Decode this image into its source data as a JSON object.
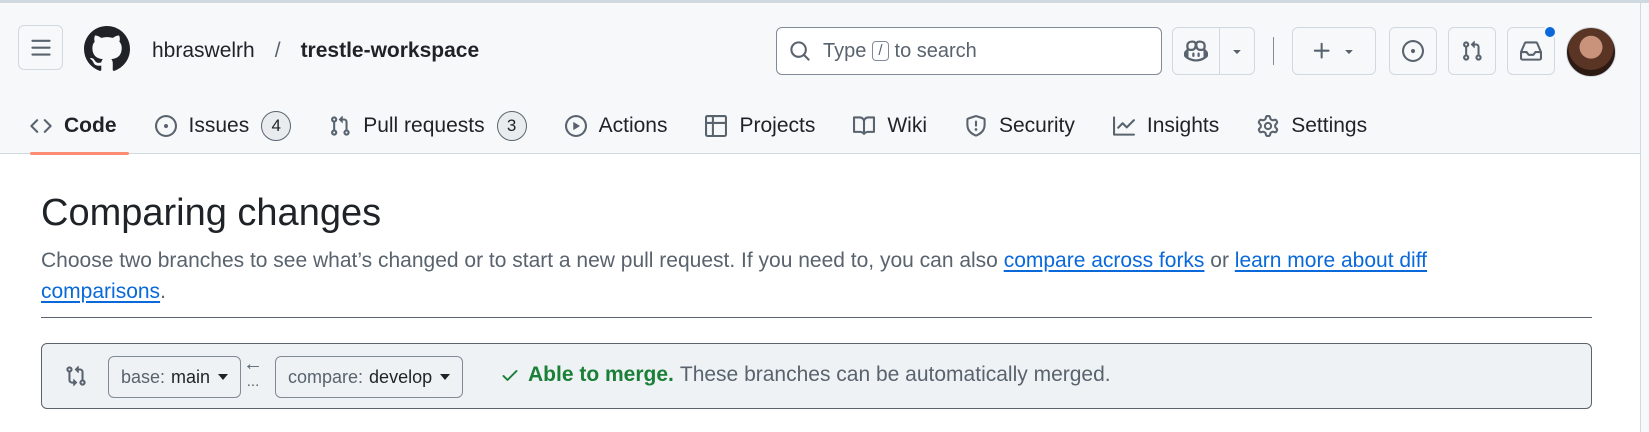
{
  "header": {
    "owner": "hbraswelrh",
    "separator": "/",
    "repo": "trestle-workspace",
    "search": {
      "prefix": "Type",
      "key": "/",
      "suffix": "to search"
    }
  },
  "repo_nav": {
    "tabs": [
      {
        "label": "Code",
        "icon": "code-icon",
        "active": true
      },
      {
        "label": "Issues",
        "icon": "issue-icon",
        "count": "4"
      },
      {
        "label": "Pull requests",
        "icon": "pull-request-icon",
        "count": "3"
      },
      {
        "label": "Actions",
        "icon": "play-icon"
      },
      {
        "label": "Projects",
        "icon": "table-icon"
      },
      {
        "label": "Wiki",
        "icon": "book-icon"
      },
      {
        "label": "Security",
        "icon": "shield-icon"
      },
      {
        "label": "Insights",
        "icon": "graph-icon"
      },
      {
        "label": "Settings",
        "icon": "gear-icon"
      }
    ]
  },
  "main": {
    "title": "Comparing changes",
    "description_before": "Choose two branches to see what’s changed or to start a new pull request. If you need to, you can also ",
    "link_forks": "compare across forks",
    "description_mid": " or ",
    "link_learn": "learn more about diff comparisons",
    "description_end": ".",
    "compare": {
      "base_prefix": "base:",
      "base_branch": "main",
      "compare_prefix": "compare:",
      "compare_branch": "develop",
      "arrow": "←",
      "dots": "...",
      "merge_ok": "Able to merge.",
      "merge_text": "These branches can be automatically merged."
    }
  },
  "colors": {
    "accent": "#0969da",
    "success": "#1a7f37",
    "active_tab_underline": "#fd8c73"
  }
}
